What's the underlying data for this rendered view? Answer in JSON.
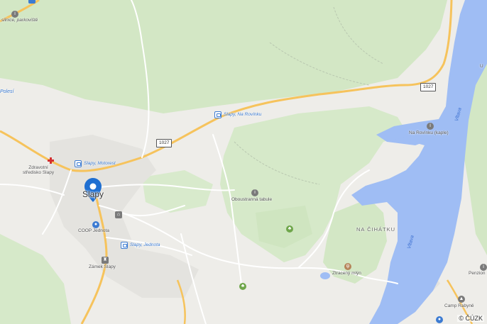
{
  "colors": {
    "land": "#eeede9",
    "forest": "#cfe5c0",
    "water": "#9fbdf4",
    "road_major": "#f6c35c",
    "road_minor": "#ffffff",
    "marker": "#1f6fd1"
  },
  "labels": {
    "top_left_poi": "silnice, parkoviště",
    "polesi": "Polesí",
    "bus_rovinku": "Slapy, Na Rovínku",
    "bus_motorest": "Slapy, Motorest",
    "bus_jednota": "Slapy, Jednota",
    "zdravotni": "Zdravotní\nstředisko Slapy",
    "town": "Slapy",
    "coop": "COOP Jednota",
    "zamek": "Zámek Slapy",
    "oboustranna": "Oboustranná tabule",
    "na_cihatku": "NA ČIHÁTKU",
    "ztraceny": "Ztracený mlýn",
    "na_rovinku_kaple": "Na Rovínku (kaple)",
    "vltava_1": "Vltava",
    "vltava_2": "Vltava",
    "penzion": "Penzion",
    "camp": "Camp Rabyně",
    "top_right_partial": "U"
  },
  "shields": {
    "road_1027_a": "1027",
    "road_1027_b": "1027"
  },
  "icons": {
    "marker": "location-pin-icon",
    "bus": "bus-stop-icon",
    "hospital": "hospital-cross-icon",
    "info": "info-icon",
    "park": "park-icon",
    "restaurant": "restaurant-icon",
    "shop": "shopping-bag-icon",
    "castle": "castle-icon",
    "camp": "camp-icon"
  },
  "attribution": "© ČÚZK"
}
